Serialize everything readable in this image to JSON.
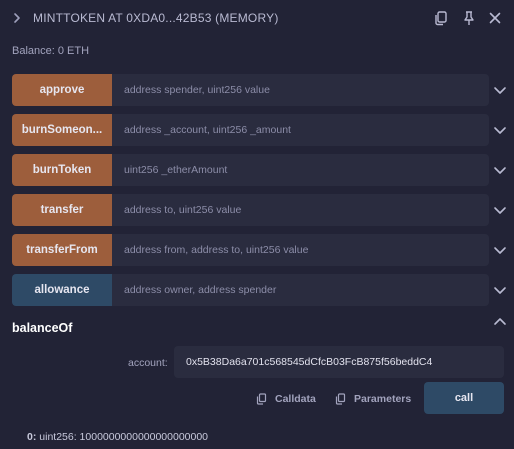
{
  "header": {
    "title": "MINTTOKEN AT 0XDA0...42B53 (MEMORY)"
  },
  "balance_text": "Balance: 0 ETH",
  "functions": [
    {
      "name": "approve",
      "params": "address spender, uint256 value",
      "kind": "transact"
    },
    {
      "name": "burnSomeon...",
      "params": "address _account, uint256 _amount",
      "kind": "transact"
    },
    {
      "name": "burnToken",
      "params": "uint256 _etherAmount",
      "kind": "transact"
    },
    {
      "name": "transfer",
      "params": "address to, uint256 value",
      "kind": "transact"
    },
    {
      "name": "transferFrom",
      "params": "address from, address to, uint256 value",
      "kind": "transact"
    },
    {
      "name": "allowance",
      "params": "address owner, address spender",
      "kind": "call"
    }
  ],
  "expanded": {
    "name": "balanceOf",
    "account_label": "account:",
    "account_value": "0x5B38Da6a701c568545dCfcB03FcB875f56beddC4",
    "calldata_label": "Calldata",
    "parameters_label": "Parameters",
    "call_label": "call",
    "result_prefix": "0:",
    "result_value": "uint256: 1000000000000000000000"
  },
  "colors": {
    "background": "#222336",
    "transact_button": "#9d5e3c",
    "call_button": "#2e4a66",
    "input_background": "#2a2c3f"
  },
  "icons": [
    "chevron-right-icon",
    "copy-icon",
    "pin-icon",
    "close-icon",
    "chevron-down-icon",
    "chevron-up-icon"
  ]
}
